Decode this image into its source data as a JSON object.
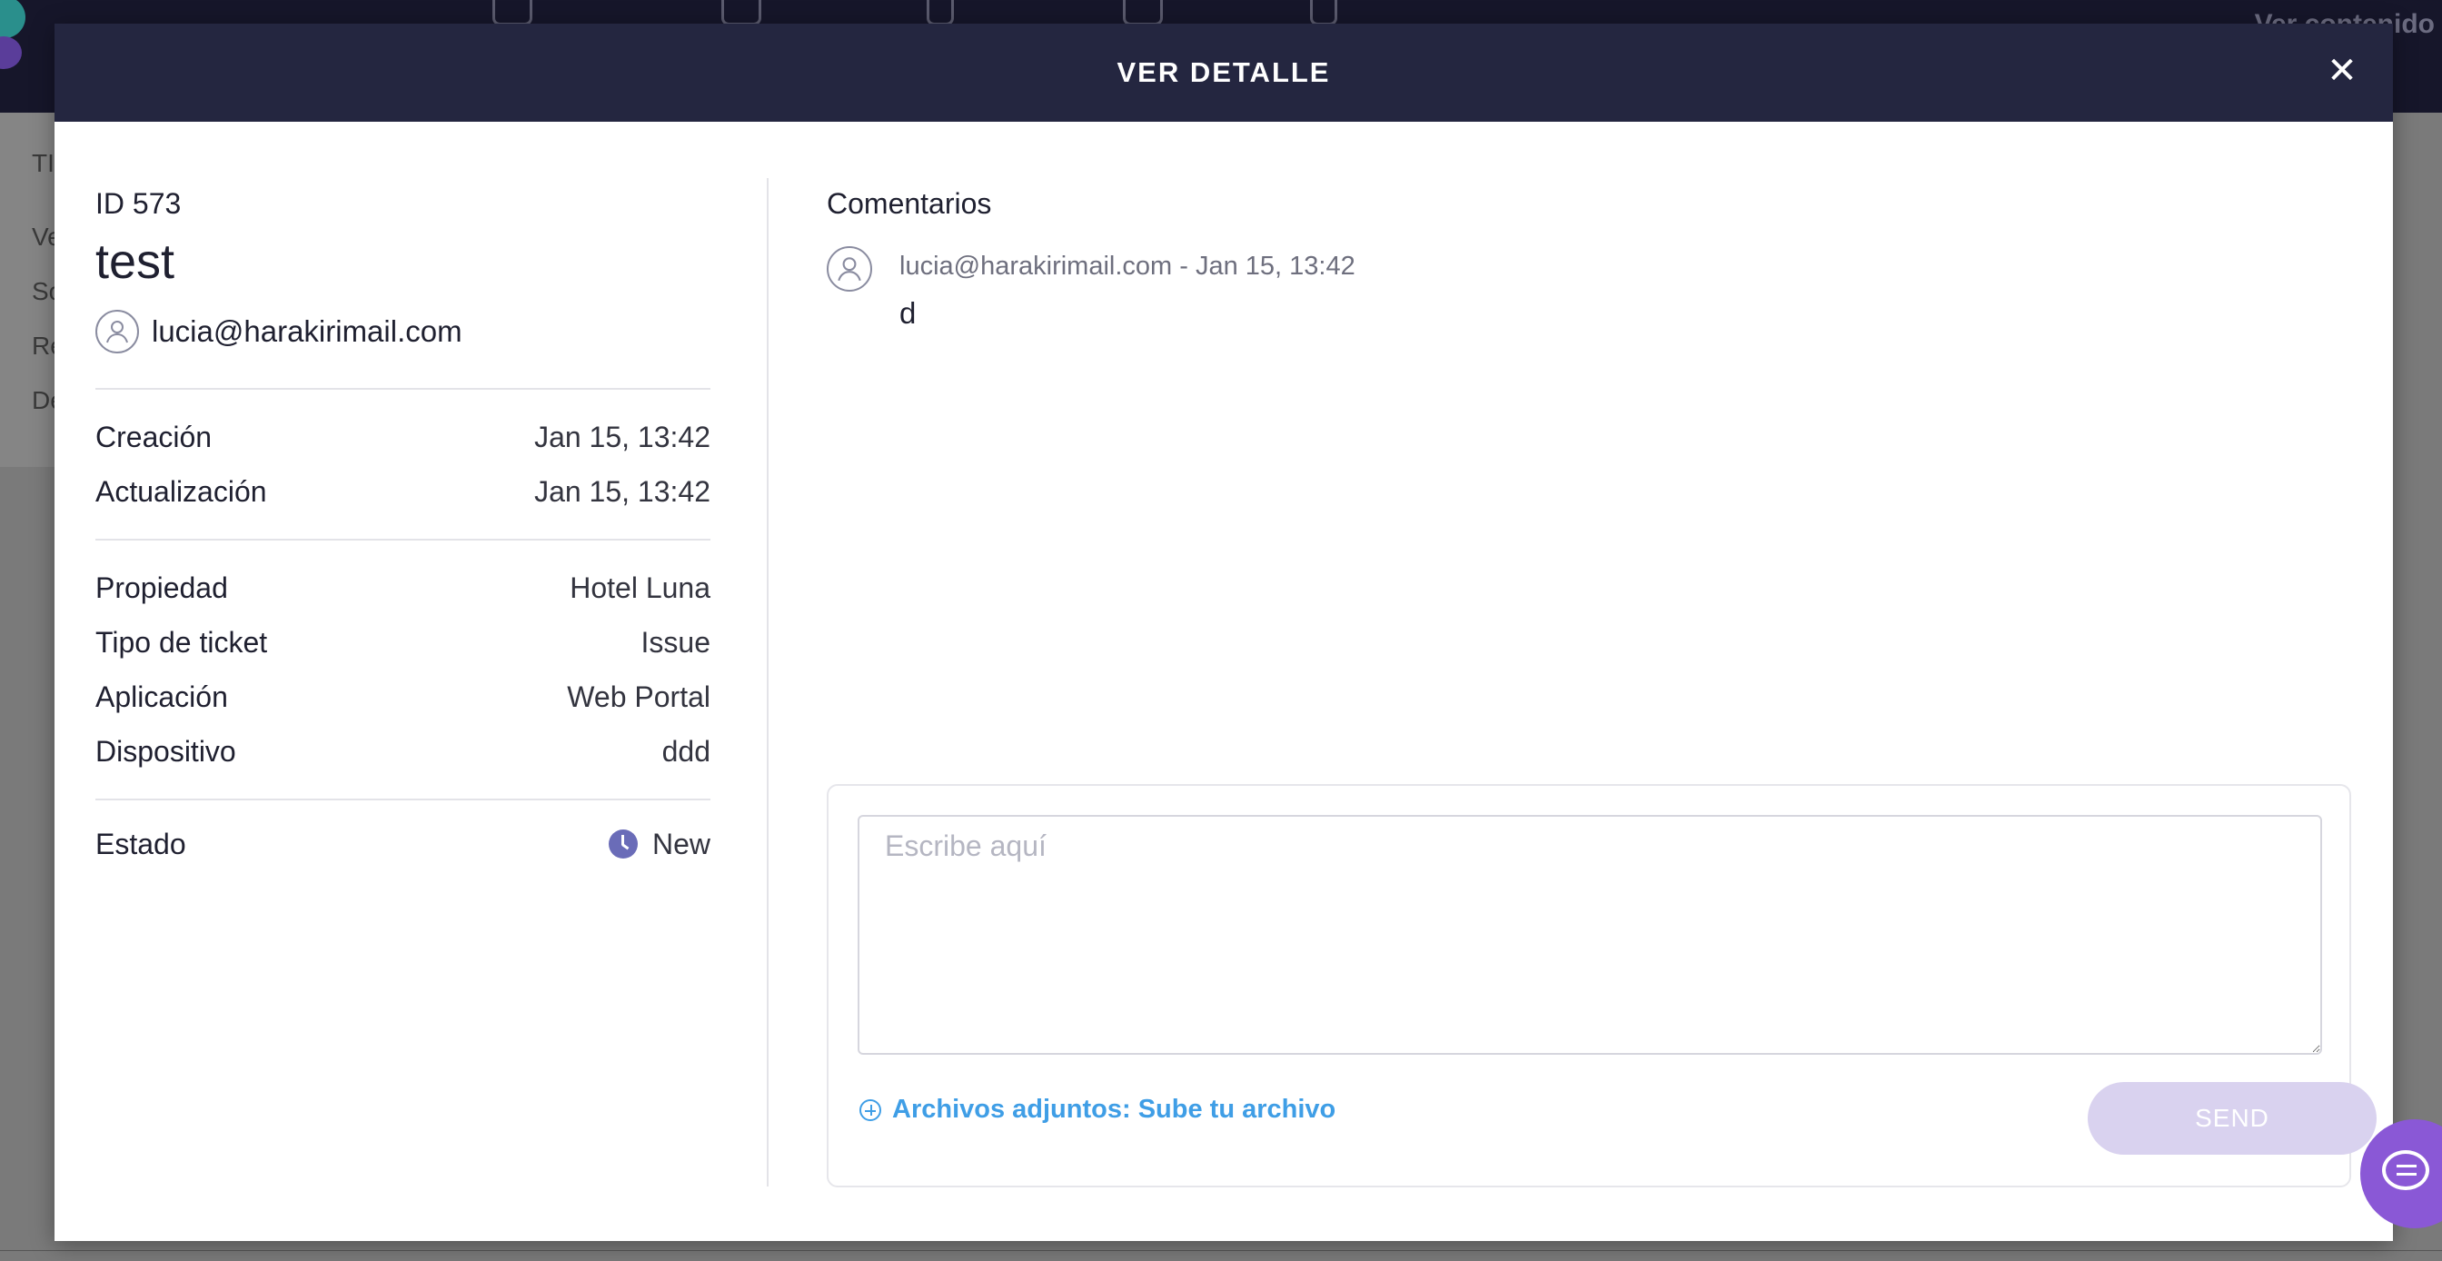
{
  "background": {
    "right_text": "Ver contenido",
    "side_letters": [
      "TI",
      "Ve",
      "So",
      "Re",
      "De"
    ]
  },
  "modal": {
    "title": "VER DETALLE",
    "close_symbol": "✕"
  },
  "ticket": {
    "id_label": "ID 573",
    "title": "test",
    "owner_email": "lucia@harakirimail.com",
    "fields": [
      {
        "label": "Creación",
        "value": "Jan 15, 13:42"
      },
      {
        "label": "Actualización",
        "value": "Jan 15, 13:42"
      },
      {
        "label": "Propiedad",
        "value": "Hotel Luna"
      },
      {
        "label": "Tipo de ticket",
        "value": "Issue"
      },
      {
        "label": "Aplicación",
        "value": "Web Portal"
      },
      {
        "label": "Dispositivo",
        "value": "ddd"
      }
    ],
    "status_label": "Estado",
    "status_value": "New",
    "status_color": "#6a6cb8"
  },
  "comments": {
    "title": "Comentarios",
    "items": [
      {
        "meta": "lucia@harakirimail.com - Jan 15, 13:42",
        "text": "d"
      }
    ]
  },
  "compose": {
    "placeholder": "Escribe aquí",
    "attach_label": "Archivos adjuntos: Sube tu archivo",
    "send_label": "SEND"
  },
  "colors": {
    "header_bg": "#242640",
    "link": "#3f9ee6",
    "send_disabled": "#d9d2ef",
    "chat_fab": "#8a58d6"
  }
}
